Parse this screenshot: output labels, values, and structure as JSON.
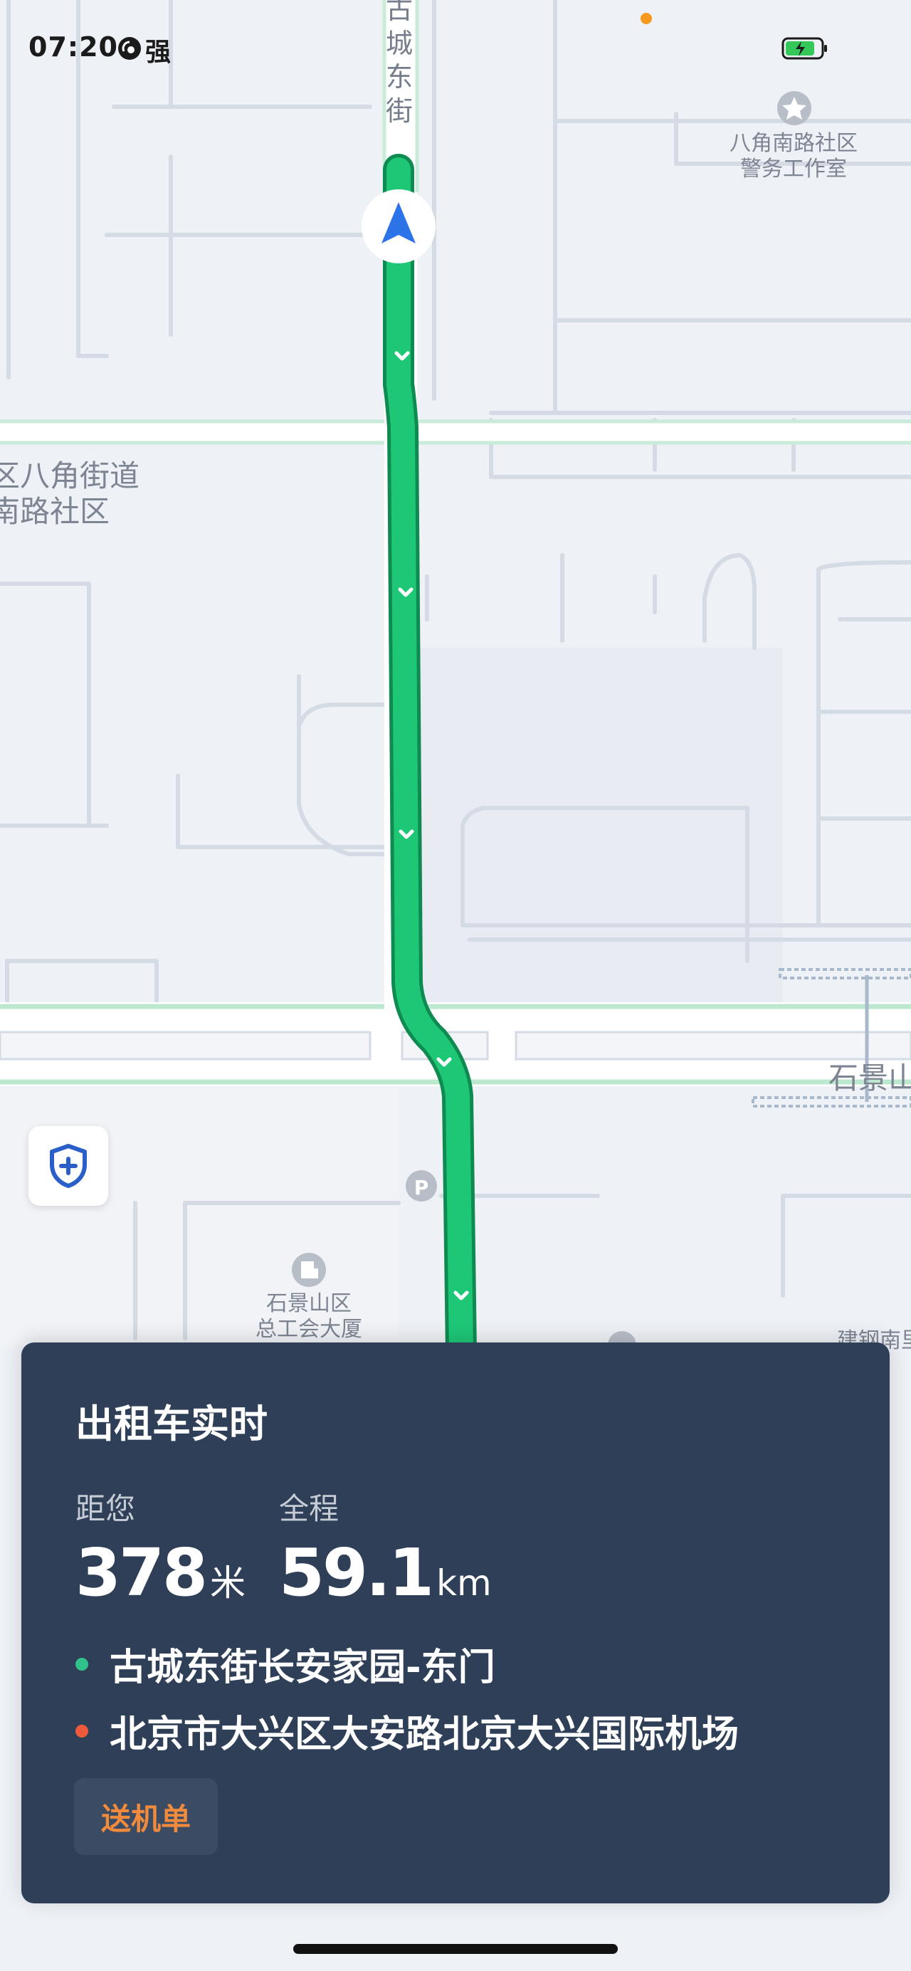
{
  "status_bar": {
    "time": "07:20",
    "carrier": "强",
    "signal_icon": "hd-signal-icon",
    "battery_icon": "battery-charging-icon"
  },
  "map": {
    "street_label": "古城东街",
    "poi_police": "八角南路社区\n警务工作室",
    "poi_community": "区八角街道\n南路社区",
    "poi_union": "石景山区\n总工会大厦",
    "poi_edge": "石景山",
    "poi_edge_bottom": "建钢南里",
    "parking_icon": "parking-icon",
    "route_color": "#1ec776"
  },
  "safety_button": {
    "icon": "shield-plus-icon"
  },
  "order_card": {
    "title": "出租车实时",
    "distance_label": "距您",
    "distance_value": "378",
    "distance_unit": "米",
    "total_label": "全程",
    "total_value": "59.1",
    "total_unit": "km",
    "origin": "古城东街长安家园-东门",
    "destination": "北京市大兴区大安路北京大兴国际机场",
    "origin_color": "#2fc28a",
    "destination_color": "#ef5a3c",
    "tag": "送机单",
    "tag_color": "#f08a3c"
  }
}
